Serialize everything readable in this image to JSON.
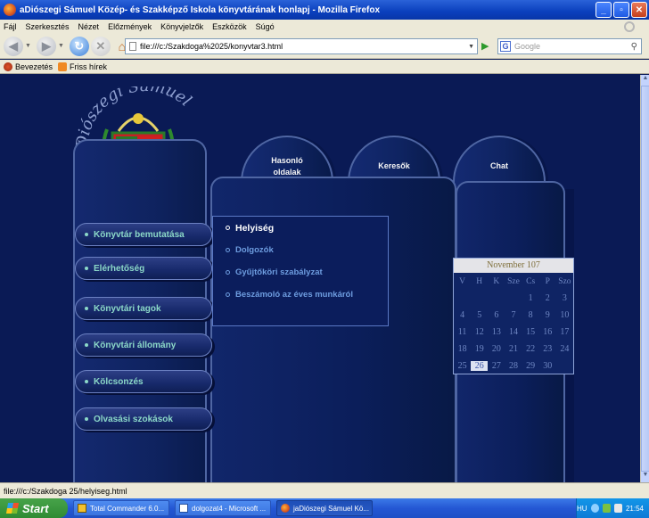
{
  "window": {
    "title": "aDiószegi Sámuel Közép- és Szakképző Iskola könyvtárának honlapj - Mozilla Firefox"
  },
  "menubar": [
    "Fájl",
    "Szerkesztés",
    "Nézet",
    "Előzmények",
    "Könyvjelzők",
    "Eszközök",
    "Súgó"
  ],
  "navbar": {
    "url": "file:///c:/Szakdoga%2025/konyvtar3.html",
    "search_placeholder": "Google"
  },
  "bookmarks": [
    {
      "label": "Bevezetés",
      "icon": "flame-icon"
    },
    {
      "label": "Friss hírek",
      "icon": "rss-icon"
    }
  ],
  "page": {
    "crest_text": "Diószegi Sámuel Közép- és Szakképző Iskola",
    "tabs": [
      "Hasonló\noldalak",
      "Keresők",
      "Chat"
    ],
    "nav": [
      "Könyvtár bemutatása",
      "Elérhetőség",
      "Könyvtári tagok",
      "Könyvtári állomány",
      "Kölcsonzés",
      "Olvasási szokások"
    ],
    "submenu": [
      "Helyiség",
      "Dolgozók",
      "Gyűjtőköri szabályzat",
      "Beszámoló az éves munkáról"
    ],
    "calendar": {
      "title": "November 107",
      "days": [
        "V",
        "H",
        "K",
        "Sze",
        "Cs",
        "P",
        "Szo"
      ],
      "weeks": [
        [
          "",
          "",
          "",
          "",
          "1",
          "2",
          "3"
        ],
        [
          "4",
          "5",
          "6",
          "7",
          "8",
          "9",
          "10"
        ],
        [
          "11",
          "12",
          "13",
          "14",
          "15",
          "16",
          "17"
        ],
        [
          "18",
          "19",
          "20",
          "21",
          "22",
          "23",
          "24"
        ],
        [
          "25",
          "26",
          "27",
          "28",
          "29",
          "30",
          ""
        ]
      ],
      "today": "26"
    }
  },
  "statusbar": {
    "text": "file:///c:/Szakdoga 25/helyiseg.html"
  },
  "taskbar": {
    "start": "Start",
    "items": [
      {
        "label": "Total Commander 6.0...",
        "active": false
      },
      {
        "label": "dolgozat4 - Microsoft ...",
        "active": false
      },
      {
        "label": "jaDiószegi Sámuel Kö...",
        "active": true
      }
    ],
    "lang": "HU",
    "time": "21:54"
  },
  "colors": {
    "page_bg": "#0a1a55",
    "nav_text": "#8cd9c8",
    "submenu_text": "#6e9de0"
  }
}
